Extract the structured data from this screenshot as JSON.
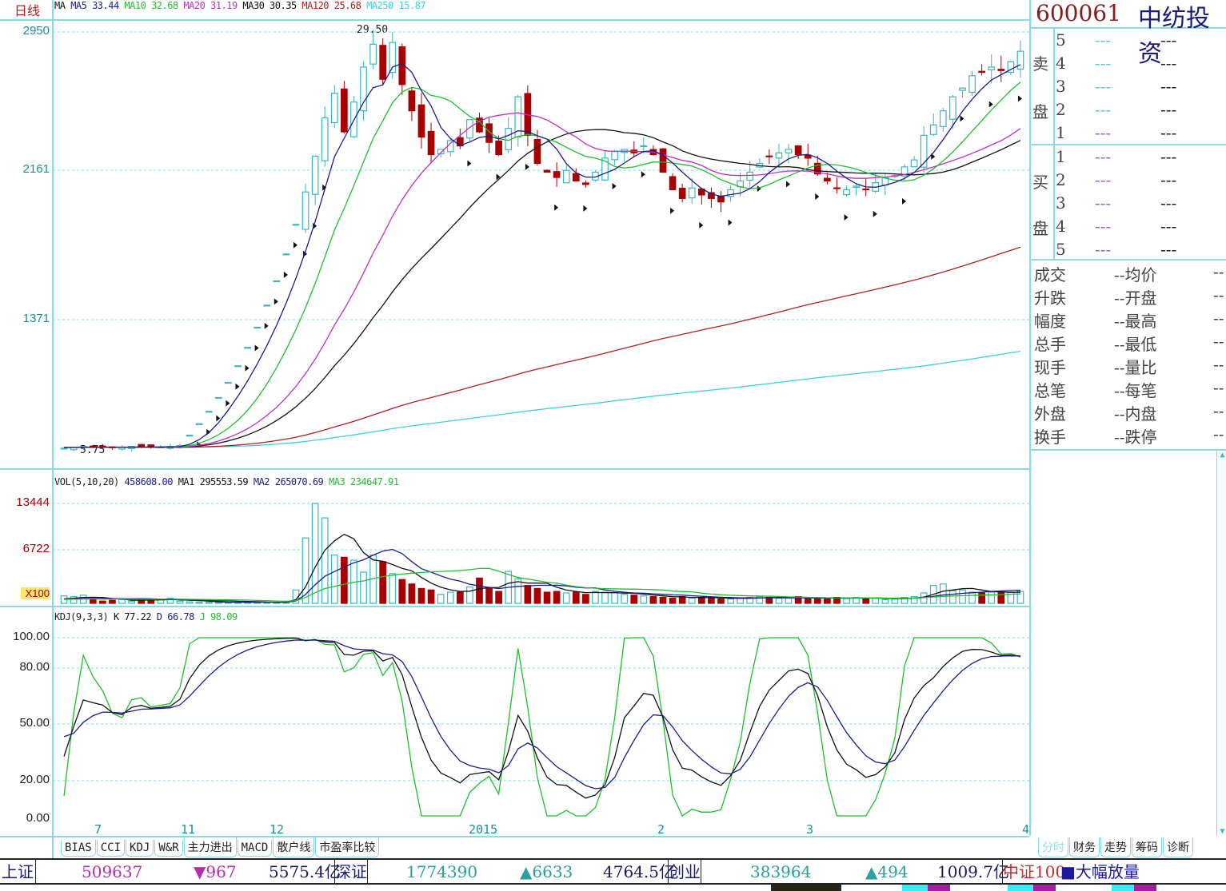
{
  "header": {
    "period": "日线",
    "ma_label": "MA",
    "ma5": "MA5 33.44",
    "ma10": "MA10 32.68",
    "ma20": "MA20 31.19",
    "ma30": "MA30 30.35",
    "ma120": "MA120 25.68",
    "ma250": "MA250 15.87",
    "high_mark": "29.50",
    "low_mark": "5.75"
  },
  "stock": {
    "code": "600061",
    "name": "中纺投资"
  },
  "colors": {
    "up": "#3bb5c4",
    "down": "#a80000",
    "ma5": "#1c1c8c",
    "ma10": "#1fbf2f",
    "ma20": "#c030c0",
    "ma30": "#111111",
    "ma120": "#b02020",
    "ma250": "#40d0e0",
    "grid": "#86dbe4"
  },
  "price_axis": [
    "2950",
    "2161",
    "1371"
  ],
  "vol_axis": [
    "13444",
    "6722",
    "X100"
  ],
  "kdj_axis": [
    "100.00",
    "80.00",
    "50.00",
    "20.00",
    "0.00"
  ],
  "x_axis": [
    "7",
    "11",
    "12",
    "2015",
    "2",
    "3",
    "4"
  ],
  "vol_legend": {
    "name": "VOL(5,10,20)",
    "vol": "458608.00",
    "ma1": "MA1 295553.59",
    "ma2": "MA2 265070.69",
    "ma3": "MA3 234647.91"
  },
  "kdj_legend": {
    "name": "KDJ(9,3,3)",
    "k": "K 77.22",
    "d": "D 66.78",
    "j": "J 98.09"
  },
  "indicator_tabs": [
    "BIAS",
    "CCI",
    "KDJ",
    "W&R",
    "主力进出",
    "MACD",
    "散户线",
    "市盈率比较"
  ],
  "right_tabs": [
    "分时",
    "财务",
    "走势",
    "筹码",
    "诊断"
  ],
  "order_book": {
    "sell_label": [
      "卖",
      "盘"
    ],
    "buy_label": [
      "买",
      "盘"
    ],
    "sell_levels": [
      "5",
      "4",
      "3",
      "2",
      "1"
    ],
    "buy_levels": [
      "1",
      "2",
      "3",
      "4",
      "5"
    ],
    "empty": "---"
  },
  "quote": {
    "left": [
      "成交",
      "升跌",
      "幅度",
      "总手",
      "现手",
      "总笔",
      "外盘",
      "换手"
    ],
    "right": [
      "均价",
      "开盘",
      "最高",
      "最低",
      "量比",
      "每笔",
      "内盘",
      "跌停"
    ],
    "empty": "--"
  },
  "status": {
    "sh_label": "上证",
    "sh_vol": "509637",
    "sh_chg": "▼967",
    "sh_amt": "5575.4亿",
    "sz_label": "深证",
    "sz_vol": "1774390",
    "sz_chg": "▲6633",
    "sz_amt": "4764.5亿",
    "cy_label": "创业",
    "cy_vol": "383964",
    "cy_chg": "▲494",
    "cy_amt": "1009.7亿",
    "zz_label": "中证100",
    "alert": "■大幅放量"
  },
  "chart_data": {
    "type": "candlestick",
    "ylim_price": [
      5.0,
      29.5
    ],
    "closes": [
      5.75,
      5.8,
      5.85,
      5.8,
      5.82,
      5.78,
      5.8,
      5.85,
      5.83,
      5.8,
      5.82,
      5.85,
      5.9,
      6.49,
      7.14,
      7.85,
      8.64,
      9.5,
      10.45,
      11.5,
      12.65,
      13.91,
      15.3,
      16.83,
      18.52,
      20.37,
      22.41,
      24.6,
      26.0,
      23.8,
      25.5,
      27.5,
      28.8,
      26.8,
      28.9,
      26.5,
      25.0,
      23.5,
      22.5,
      22.8,
      23.3,
      23.0,
      24.5,
      23.8,
      23.2,
      22.5,
      24.0,
      25.8,
      23.6,
      22.0,
      21.5,
      21.2,
      21.6,
      21.0,
      20.8,
      21.5,
      22.3,
      22.7,
      22.8,
      22.6,
      23.0,
      22.5,
      21.5,
      20.5,
      20.0,
      20.6,
      20.2,
      20.0,
      19.8,
      20.5,
      21.0,
      21.5,
      22.0,
      22.4,
      22.6,
      22.8,
      22.5,
      22.3,
      21.4,
      21.0,
      20.6,
      20.5,
      20.7,
      20.5,
      20.9,
      21.2,
      21.3,
      21.8,
      22.2,
      23.6,
      24.2,
      25.0,
      25.8,
      26.3,
      27.0,
      27.2,
      27.5,
      27.3,
      27.8,
      28.4
    ],
    "volumes": [
      1000,
      900,
      1100,
      600,
      300,
      400,
      500,
      300,
      600,
      400,
      500,
      700,
      300,
      200,
      150,
      150,
      150,
      150,
      150,
      150,
      150,
      150,
      150,
      150,
      1800,
      8800,
      13444,
      11500,
      6500,
      6200,
      5800,
      4200,
      6500,
      5600,
      4000,
      3200,
      2600,
      2000,
      1800,
      1200,
      1500,
      1500,
      2200,
      3400,
      2000,
      1600,
      4300,
      3300,
      2400,
      2000,
      1500,
      1600,
      1400,
      1500,
      1200,
      1600,
      1500,
      1400,
      1200,
      1100,
      1000,
      900,
      800,
      700,
      900,
      700,
      800,
      700,
      600,
      600,
      700,
      800,
      900,
      800,
      700,
      700,
      900,
      600,
      700,
      600,
      800,
      700,
      800,
      600,
      700,
      500,
      600,
      800,
      900,
      1400,
      2400,
      2600,
      1700,
      1800,
      1500,
      1400,
      1500,
      1500,
      1500,
      1600
    ],
    "vol_ylim": [
      0,
      13444
    ],
    "kdj_ylim": [
      0,
      100
    ]
  }
}
